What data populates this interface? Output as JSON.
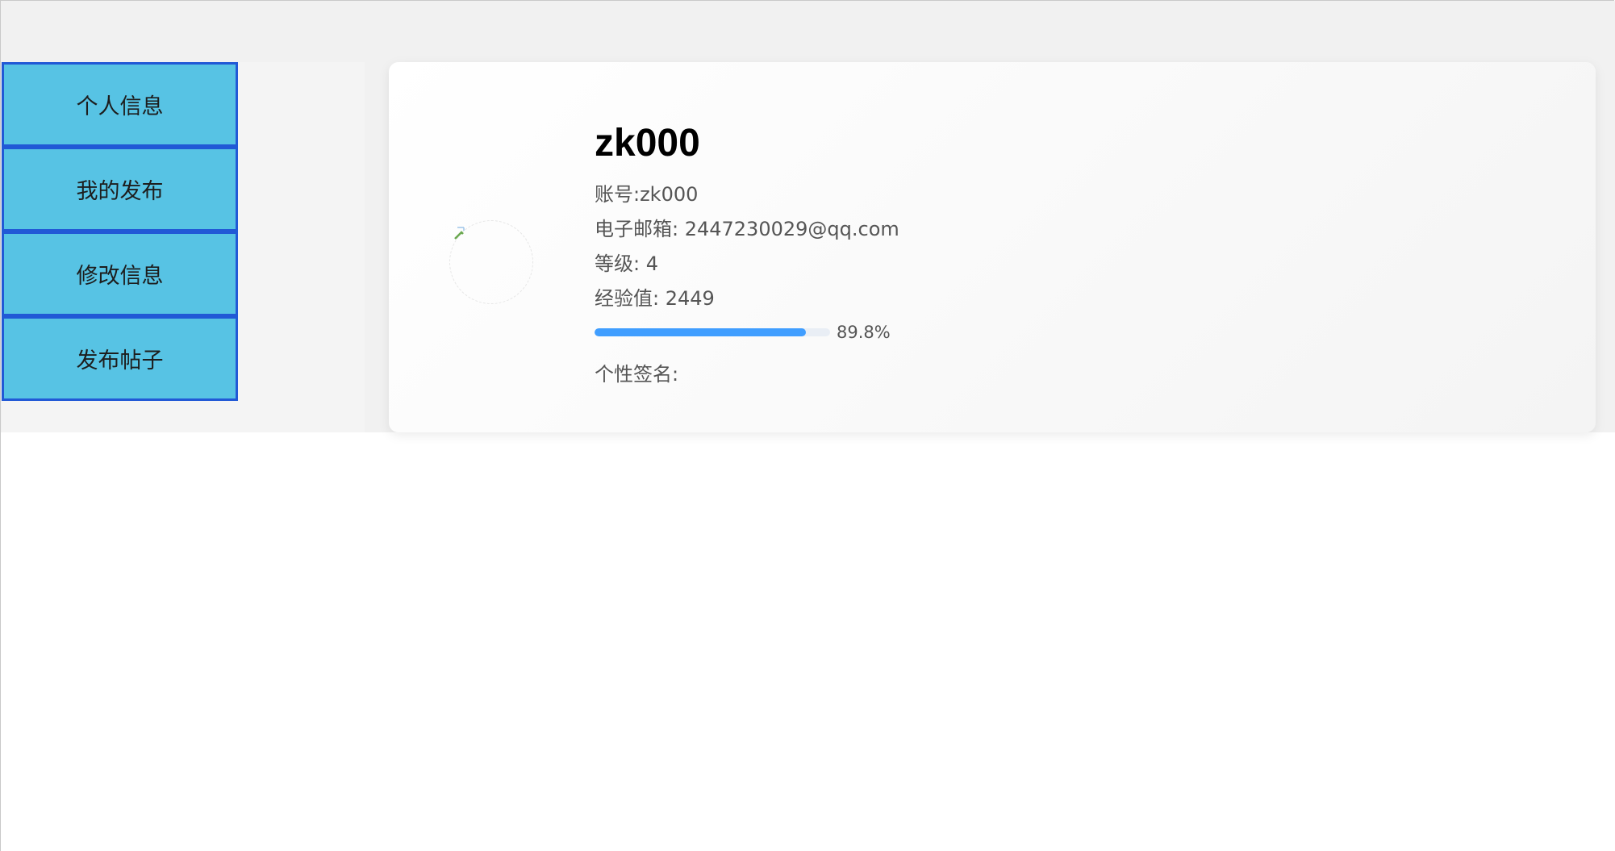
{
  "sidebar": {
    "items": [
      {
        "label": "个人信息"
      },
      {
        "label": "我的发布"
      },
      {
        "label": "修改信息"
      },
      {
        "label": "发布帖子"
      }
    ]
  },
  "profile": {
    "username": "zk000",
    "account": "账号:zk000",
    "email": "电子邮箱: 2447230029@qq.com",
    "level": "等级: 4",
    "experience": "经验值: 2449",
    "progress_percent": 89.8,
    "progress_label": "89.8%",
    "signature_label": "个性签名:",
    "avatar_icon": "broken-image-icon"
  },
  "colors": {
    "menu_bg": "#57c3e4",
    "menu_border": "#2159d6",
    "progress_fill": "#409eff",
    "progress_track": "#e9eef5"
  }
}
